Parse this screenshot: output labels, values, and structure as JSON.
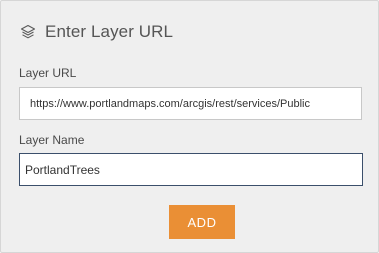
{
  "dialog": {
    "title": "Enter Layer URL",
    "title_icon": "layers-icon"
  },
  "form": {
    "url_label": "Layer URL",
    "url_value": "https://www.portlandmaps.com/arcgis/rest/services/Public",
    "name_label": "Layer Name",
    "name_value": "PortlandTrees",
    "add_label": "ADD"
  },
  "colors": {
    "panel_bg": "#efefef",
    "accent": "#ea8f35",
    "focus_border": "#3b4f6b"
  }
}
